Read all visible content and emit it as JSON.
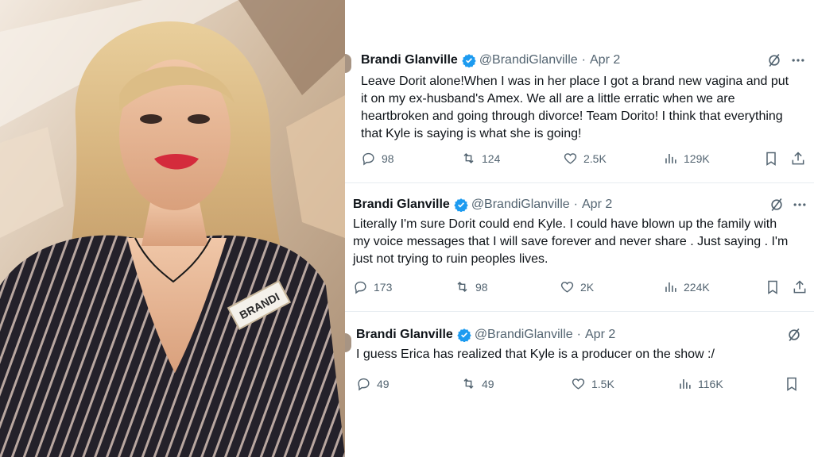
{
  "photo": {
    "name_tag": "BRANDI"
  },
  "tweets": [
    {
      "name": "Brandi Glanville",
      "handle": "@BrandiGlanville",
      "date": "Apr 2",
      "lines": [
        "Leave Dorit  alone!When I was in her place I got a brand new vagina and put",
        "it on my ex-husband's Amex. We all are a little erratic when we are",
        "heartbroken and going through divorce! Team Dorito! I think that everything",
        "that Kyle is saying is what she is going!"
      ],
      "replies": "98",
      "reposts": "124",
      "likes": "2.5K",
      "views": "129K"
    },
    {
      "name": "Brandi Glanville",
      "handle": "@BrandiGlanville",
      "date": "Apr 2",
      "lines": [
        "Literally I'm sure Dorit could end Kyle. I could have blown up the family with",
        "my voice messages that I will save forever and never share . Just saying . I'm",
        "just not trying to ruin peoples lives."
      ],
      "replies": "173",
      "reposts": "98",
      "likes": "2K",
      "views": "224K"
    },
    {
      "name": "Brandi Glanville",
      "handle": "@BrandiGlanville",
      "date": "Apr 2",
      "lines": [
        "I guess Erica has realized that Kyle is a producer on the show :/"
      ],
      "replies": "49",
      "reposts": "49",
      "likes": "1.5K",
      "views": "116K"
    }
  ],
  "colors": {
    "text": "#0f1419",
    "secondary": "#536471",
    "verified": "#1d9bf0"
  },
  "icons": [
    "verified-badge-icon",
    "grok-icon",
    "more-icon",
    "reply-icon",
    "repost-icon",
    "like-icon",
    "views-icon",
    "bookmark-icon",
    "share-icon"
  ]
}
